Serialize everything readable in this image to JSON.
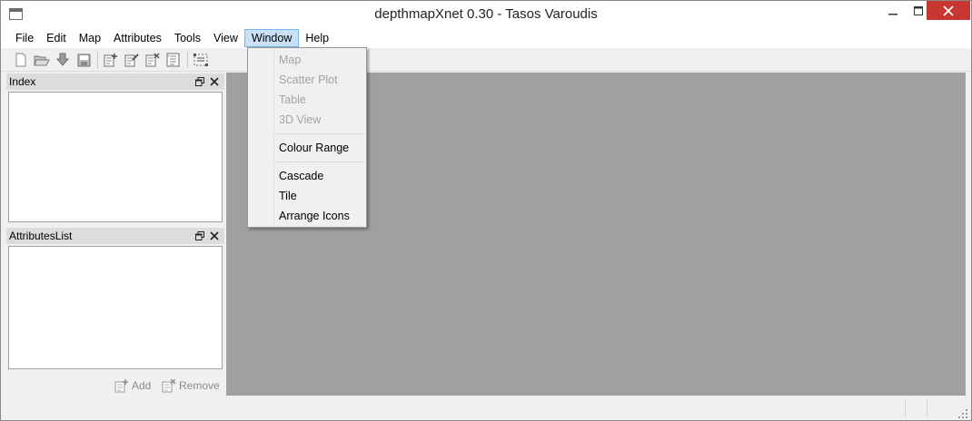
{
  "window": {
    "title": "depthmapXnet 0.30 - Tasos Varoudis"
  },
  "menubar": {
    "items": [
      {
        "label": "File"
      },
      {
        "label": "Edit"
      },
      {
        "label": "Map"
      },
      {
        "label": "Attributes"
      },
      {
        "label": "Tools"
      },
      {
        "label": "View"
      },
      {
        "label": "Window",
        "active": true
      },
      {
        "label": "Help"
      }
    ]
  },
  "toolbar": {
    "icons": [
      "new-icon",
      "open-icon",
      "import-icon",
      "save-icon",
      "add-layer-icon",
      "edit-layer-icon",
      "delete-layer-icon",
      "properties-icon",
      "select-all-icon"
    ]
  },
  "window_menu": {
    "items": [
      {
        "label": "Map",
        "enabled": false
      },
      {
        "label": "Scatter Plot",
        "enabled": false
      },
      {
        "label": "Table",
        "enabled": false
      },
      {
        "label": "3D View",
        "enabled": false
      },
      {
        "label": "Colour Range",
        "enabled": true
      },
      {
        "label": "Cascade",
        "enabled": true
      },
      {
        "label": "Tile",
        "enabled": true
      },
      {
        "label": "Arrange Icons",
        "enabled": true
      }
    ]
  },
  "panels": {
    "index": {
      "title": "Index"
    },
    "attributes": {
      "title": "AttributesList"
    }
  },
  "attribute_actions": {
    "add_label": "Add",
    "remove_label": "Remove"
  },
  "colors": {
    "mdi_background": "#a0a0a0",
    "menu_highlight": "#c9e0f7",
    "close_button": "#c7372f",
    "disabled_text": "#a2a2a2"
  }
}
